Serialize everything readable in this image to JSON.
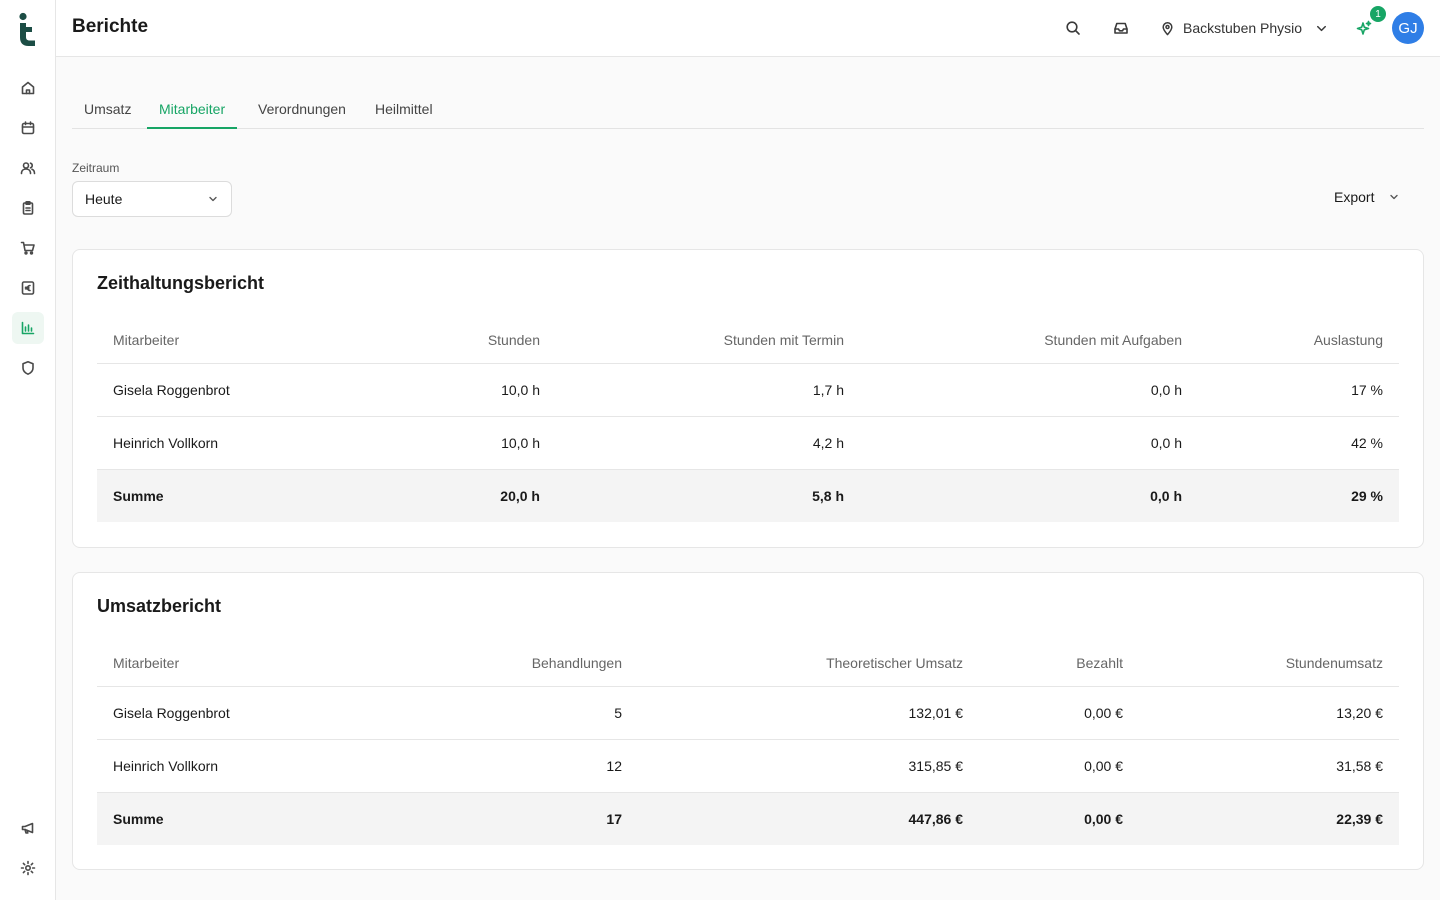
{
  "app": {
    "page_title": "Berichte",
    "location": "Backstuben Physio",
    "notification_count": "1",
    "avatar_initials": "GJ",
    "accent_color": "#17a565",
    "logo_color": "#1c4d45",
    "avatar_color": "#2f7ee6"
  },
  "sidebar": {
    "items": [
      {
        "icon": "home-icon"
      },
      {
        "icon": "calendar-icon"
      },
      {
        "icon": "users-icon"
      },
      {
        "icon": "clipboard-icon"
      },
      {
        "icon": "cart-icon"
      },
      {
        "icon": "euro-icon"
      },
      {
        "icon": "chart-icon",
        "active": true
      },
      {
        "icon": "shield-icon"
      }
    ],
    "bottom_items": [
      {
        "icon": "megaphone-icon"
      },
      {
        "icon": "gear-icon"
      }
    ]
  },
  "tabs": [
    {
      "label": "Umsatz"
    },
    {
      "label": "Mitarbeiter",
      "active": true
    },
    {
      "label": "Verordnungen"
    },
    {
      "label": "Heilmittel"
    }
  ],
  "filter": {
    "label": "Zeitraum",
    "value": "Heute",
    "export_label": "Export"
  },
  "time_report": {
    "title": "Zeithaltungsbericht",
    "columns": [
      "Mitarbeiter",
      "Stunden",
      "Stunden mit Termin",
      "Stunden mit Aufgaben",
      "Auslastung"
    ],
    "rows": [
      [
        "Gisela Roggenbrot",
        "10,0 h",
        "1,7 h",
        "0,0 h",
        "17 %"
      ],
      [
        "Heinrich Vollkorn",
        "10,0 h",
        "4,2 h",
        "0,0 h",
        "42 %"
      ]
    ],
    "sum": [
      "Summe",
      "20,0 h",
      "5,8 h",
      "0,0 h",
      "29 %"
    ]
  },
  "revenue_report": {
    "title": "Umsatzbericht",
    "columns": [
      "Mitarbeiter",
      "Behandlungen",
      "Theoretischer Umsatz",
      "Bezahlt",
      "Stundenumsatz"
    ],
    "rows": [
      [
        "Gisela Roggenbrot",
        "5",
        "132,01 €",
        "0,00 €",
        "13,20 €"
      ],
      [
        "Heinrich Vollkorn",
        "12",
        "315,85 €",
        "0,00 €",
        "31,58 €"
      ]
    ],
    "sum": [
      "Summe",
      "17",
      "447,86 €",
      "0,00 €",
      "22,39 €"
    ]
  }
}
